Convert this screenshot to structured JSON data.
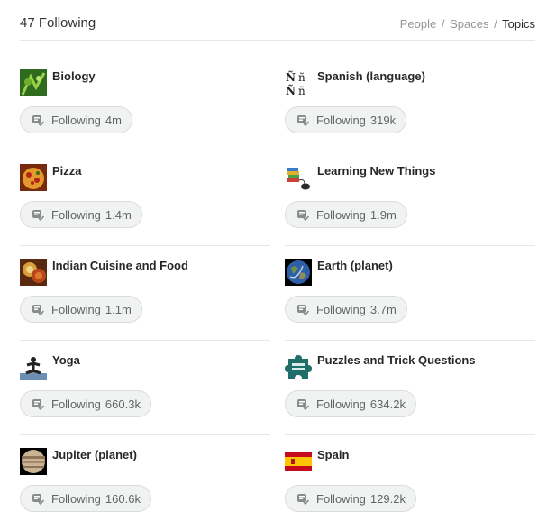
{
  "header": {
    "count_label": "47 Following",
    "filters": {
      "people": "People",
      "spaces": "Spaces",
      "topics": "Topics",
      "separator": "/"
    }
  },
  "topics": [
    {
      "name": "Biology",
      "status": "Following",
      "count": "4m",
      "icon": "biology-image"
    },
    {
      "name": "Spanish (language)",
      "status": "Following",
      "count": "319k",
      "icon": "spanish-letters-image"
    },
    {
      "name": "Pizza",
      "status": "Following",
      "count": "1.4m",
      "icon": "pizza-image"
    },
    {
      "name": "Learning New Things",
      "status": "Following",
      "count": "1.9m",
      "icon": "books-mouse-image"
    },
    {
      "name": "Indian Cuisine and Food",
      "status": "Following",
      "count": "1.1m",
      "icon": "indian-food-image"
    },
    {
      "name": "Earth (planet)",
      "status": "Following",
      "count": "3.7m",
      "icon": "earth-image"
    },
    {
      "name": "Yoga",
      "status": "Following",
      "count": "660.3k",
      "icon": "yoga-image"
    },
    {
      "name": "Puzzles and Trick Questions",
      "status": "Following",
      "count": "634.2k",
      "icon": "puzzle-image"
    },
    {
      "name": "Jupiter (planet)",
      "status": "Following",
      "count": "160.6k",
      "icon": "jupiter-image"
    },
    {
      "name": "Spain",
      "status": "Following",
      "count": "129.2k",
      "icon": "spain-flag-image"
    }
  ],
  "colors": {
    "pill_bg": "#f1f2f2",
    "divider": "#e6e6e6",
    "muted": "#939598"
  }
}
